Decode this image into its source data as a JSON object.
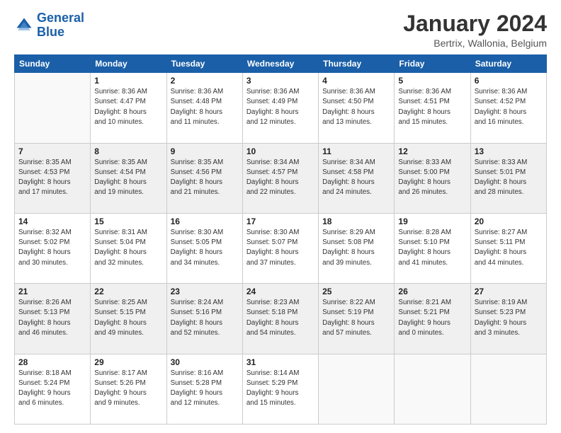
{
  "logo": {
    "line1": "General",
    "line2": "Blue"
  },
  "title": "January 2024",
  "subtitle": "Bertrix, Wallonia, Belgium",
  "weekdays": [
    "Sunday",
    "Monday",
    "Tuesday",
    "Wednesday",
    "Thursday",
    "Friday",
    "Saturday"
  ],
  "weeks": [
    [
      {
        "day": "",
        "info": ""
      },
      {
        "day": "1",
        "info": "Sunrise: 8:36 AM\nSunset: 4:47 PM\nDaylight: 8 hours\nand 10 minutes."
      },
      {
        "day": "2",
        "info": "Sunrise: 8:36 AM\nSunset: 4:48 PM\nDaylight: 8 hours\nand 11 minutes."
      },
      {
        "day": "3",
        "info": "Sunrise: 8:36 AM\nSunset: 4:49 PM\nDaylight: 8 hours\nand 12 minutes."
      },
      {
        "day": "4",
        "info": "Sunrise: 8:36 AM\nSunset: 4:50 PM\nDaylight: 8 hours\nand 13 minutes."
      },
      {
        "day": "5",
        "info": "Sunrise: 8:36 AM\nSunset: 4:51 PM\nDaylight: 8 hours\nand 15 minutes."
      },
      {
        "day": "6",
        "info": "Sunrise: 8:36 AM\nSunset: 4:52 PM\nDaylight: 8 hours\nand 16 minutes."
      }
    ],
    [
      {
        "day": "7",
        "info": "Sunrise: 8:35 AM\nSunset: 4:53 PM\nDaylight: 8 hours\nand 17 minutes."
      },
      {
        "day": "8",
        "info": "Sunrise: 8:35 AM\nSunset: 4:54 PM\nDaylight: 8 hours\nand 19 minutes."
      },
      {
        "day": "9",
        "info": "Sunrise: 8:35 AM\nSunset: 4:56 PM\nDaylight: 8 hours\nand 21 minutes."
      },
      {
        "day": "10",
        "info": "Sunrise: 8:34 AM\nSunset: 4:57 PM\nDaylight: 8 hours\nand 22 minutes."
      },
      {
        "day": "11",
        "info": "Sunrise: 8:34 AM\nSunset: 4:58 PM\nDaylight: 8 hours\nand 24 minutes."
      },
      {
        "day": "12",
        "info": "Sunrise: 8:33 AM\nSunset: 5:00 PM\nDaylight: 8 hours\nand 26 minutes."
      },
      {
        "day": "13",
        "info": "Sunrise: 8:33 AM\nSunset: 5:01 PM\nDaylight: 8 hours\nand 28 minutes."
      }
    ],
    [
      {
        "day": "14",
        "info": "Sunrise: 8:32 AM\nSunset: 5:02 PM\nDaylight: 8 hours\nand 30 minutes."
      },
      {
        "day": "15",
        "info": "Sunrise: 8:31 AM\nSunset: 5:04 PM\nDaylight: 8 hours\nand 32 minutes."
      },
      {
        "day": "16",
        "info": "Sunrise: 8:30 AM\nSunset: 5:05 PM\nDaylight: 8 hours\nand 34 minutes."
      },
      {
        "day": "17",
        "info": "Sunrise: 8:30 AM\nSunset: 5:07 PM\nDaylight: 8 hours\nand 37 minutes."
      },
      {
        "day": "18",
        "info": "Sunrise: 8:29 AM\nSunset: 5:08 PM\nDaylight: 8 hours\nand 39 minutes."
      },
      {
        "day": "19",
        "info": "Sunrise: 8:28 AM\nSunset: 5:10 PM\nDaylight: 8 hours\nand 41 minutes."
      },
      {
        "day": "20",
        "info": "Sunrise: 8:27 AM\nSunset: 5:11 PM\nDaylight: 8 hours\nand 44 minutes."
      }
    ],
    [
      {
        "day": "21",
        "info": "Sunrise: 8:26 AM\nSunset: 5:13 PM\nDaylight: 8 hours\nand 46 minutes."
      },
      {
        "day": "22",
        "info": "Sunrise: 8:25 AM\nSunset: 5:15 PM\nDaylight: 8 hours\nand 49 minutes."
      },
      {
        "day": "23",
        "info": "Sunrise: 8:24 AM\nSunset: 5:16 PM\nDaylight: 8 hours\nand 52 minutes."
      },
      {
        "day": "24",
        "info": "Sunrise: 8:23 AM\nSunset: 5:18 PM\nDaylight: 8 hours\nand 54 minutes."
      },
      {
        "day": "25",
        "info": "Sunrise: 8:22 AM\nSunset: 5:19 PM\nDaylight: 8 hours\nand 57 minutes."
      },
      {
        "day": "26",
        "info": "Sunrise: 8:21 AM\nSunset: 5:21 PM\nDaylight: 9 hours\nand 0 minutes."
      },
      {
        "day": "27",
        "info": "Sunrise: 8:19 AM\nSunset: 5:23 PM\nDaylight: 9 hours\nand 3 minutes."
      }
    ],
    [
      {
        "day": "28",
        "info": "Sunrise: 8:18 AM\nSunset: 5:24 PM\nDaylight: 9 hours\nand 6 minutes."
      },
      {
        "day": "29",
        "info": "Sunrise: 8:17 AM\nSunset: 5:26 PM\nDaylight: 9 hours\nand 9 minutes."
      },
      {
        "day": "30",
        "info": "Sunrise: 8:16 AM\nSunset: 5:28 PM\nDaylight: 9 hours\nand 12 minutes."
      },
      {
        "day": "31",
        "info": "Sunrise: 8:14 AM\nSunset: 5:29 PM\nDaylight: 9 hours\nand 15 minutes."
      },
      {
        "day": "",
        "info": ""
      },
      {
        "day": "",
        "info": ""
      },
      {
        "day": "",
        "info": ""
      }
    ]
  ]
}
